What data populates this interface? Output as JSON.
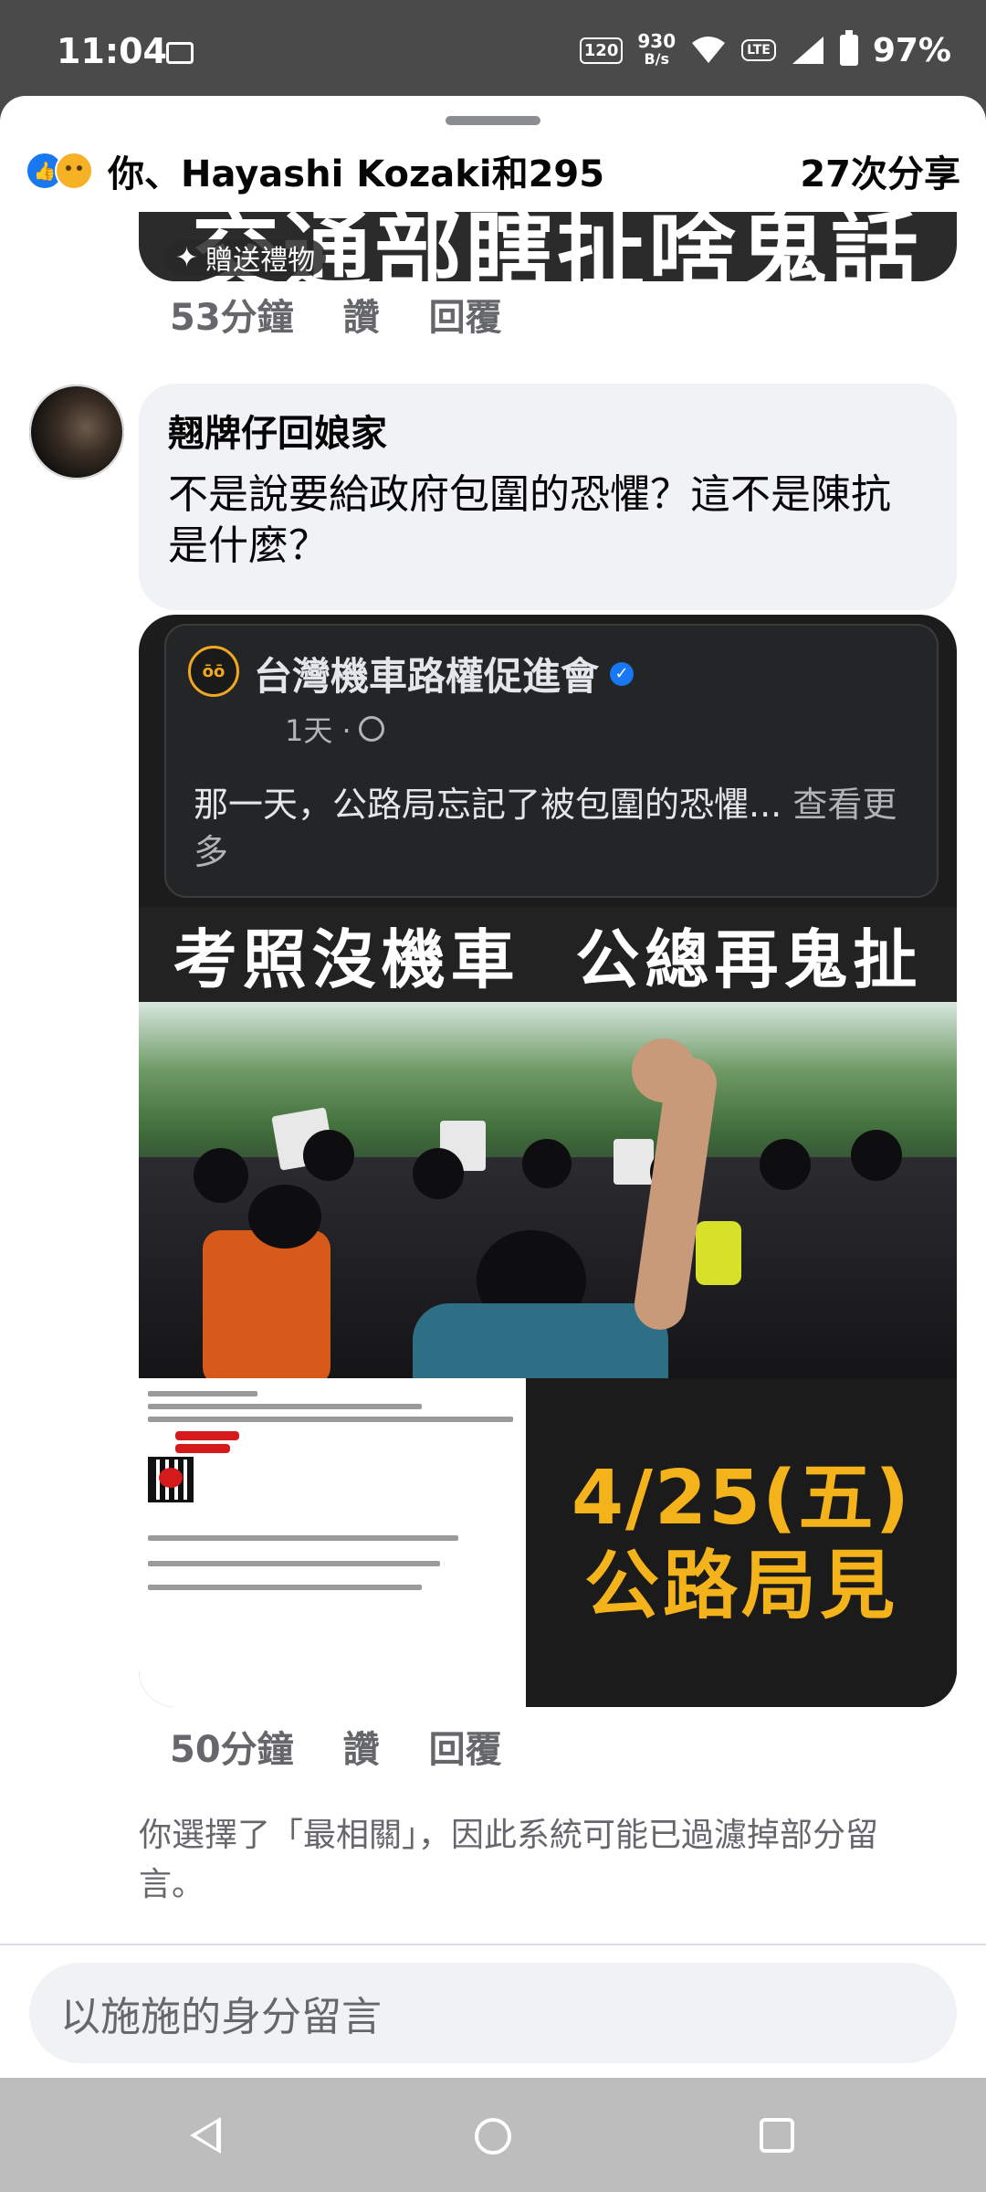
{
  "status_bar": {
    "time": "11:04",
    "refresh_rate": "120",
    "net_speed_value": "930",
    "net_speed_unit": "B/s",
    "network_badge": "LTE",
    "battery": "97%"
  },
  "reactions": {
    "summary": "你、Hayashi Kozaki和295",
    "shares": "27次分享",
    "icons": [
      "like-icon",
      "sad-icon"
    ]
  },
  "comment_1": {
    "image_text": "交通部瞎扯啥鬼話",
    "gift_label": "贈送禮物",
    "time": "53分鐘",
    "like": "讚",
    "reply": "回覆"
  },
  "comment_2": {
    "author": "翹牌仔回娘家",
    "text": "不是說要給政府包圍的恐懼？這不是陳抗是什麼？",
    "shared_post": {
      "page_name": "台灣機車路權促進會",
      "time": "1天 ·",
      "text": "那一天，公路局忘記了被包圍的恐懼...",
      "see_more": " 查看更多"
    },
    "banner": "考照沒機車  公總再鬼扯",
    "date_line1": "4/25(五)",
    "date_line2": "公路局見",
    "time": "50分鐘",
    "like": "讚",
    "reply": "回覆"
  },
  "filter_note": "你選擇了「最相關」，因此系統可能已過濾掉部分留言。",
  "composer": {
    "placeholder": "以施施的身分留言"
  },
  "colors": {
    "accent_blue": "#1877f2",
    "poster_yellow": "#f5b31b",
    "secondary_text": "#65676b"
  }
}
